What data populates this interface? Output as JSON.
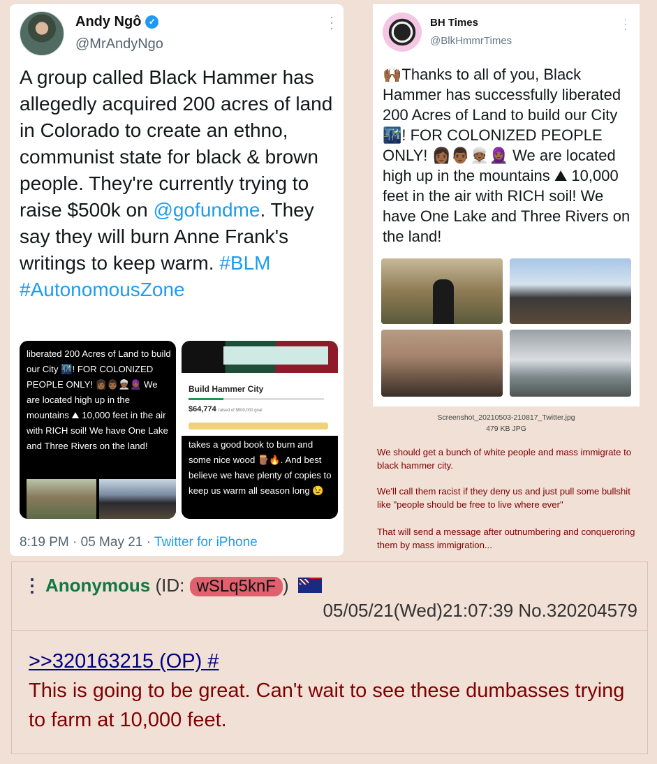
{
  "left_tweet": {
    "name": "Andy Ngô",
    "handle": "@MrAndyNgo",
    "body_main": "A group called Black Hammer has allegedly acquired 200 acres of land in Colorado to create an ethno, communist state for black & brown people. They're currently trying to raise $500k on ",
    "mention": "@gofundme",
    "body_tail": ". They say they will burn Anne Frank's writings to keep warm. ",
    "hashtag1": "#BLM",
    "hashtag2": "#AutonomousZone",
    "embed_a_text": "liberated 200 Acres of Land to build our City 🌃! FOR COLONIZED PEOPLE ONLY! 👩🏾👨🏾👳🏾🧕🏾 We are located high up in the mountains ⛰ 10,000 feet in the air with RICH soil! We have One Lake and Three Rivers on the land!",
    "embed_b_title": "Build Hammer City",
    "embed_b_amount": "$64,774",
    "embed_b_goal": "raised of $500,000 goal",
    "embed_b_text": "takes a good book to burn and some nice wood 🪵🔥. And best believe we have plenty of copies to keep us warm all season long 😉",
    "time": "8:19 PM · 05 May 21 · ",
    "source": "Twitter for iPhone"
  },
  "right_tweet": {
    "name": "BH Times",
    "handle": "@BlkHmmrTimes",
    "body": "🙌🏾Thanks to all of you, Black Hammer has successfully liberated 200 Acres of Land to build our City 🌃! FOR COLONIZED PEOPLE ONLY! 👩🏾👨🏾👳🏾🧕🏾 We are located high up in the mountains ⛰ 10,000 feet in the air with RICH soil! We have One Lake and Three Rivers on the land!"
  },
  "file": {
    "name": "Screenshot_20210503-210817_Twitter.jpg",
    "size": "479 KB JPG"
  },
  "op_message": {
    "p1": "We should get a bunch of white people and mass immigrate to black hammer city.",
    "p2": "We'll call them racist if they deny us and just pull some bullshit like \"people should be free to live where ever\"",
    "p3": "That will send a message after outnumbering and conqueroring them by mass immigration..."
  },
  "reply": {
    "menu_icon": "⋮",
    "name": "Anonymous",
    "id_prefix": "(ID: ",
    "id": "wSLq5knF",
    "id_suffix": ")",
    "datetime": "05/05/21(Wed)21:07:39 No.320204579",
    "quote": ">>320163215 (OP) #",
    "text": "This is going to be great. Can't wait to see these dumbasses trying to farm at 10,000 feet."
  },
  "colors": {
    "background": "#f0e0d6",
    "name_green": "#117743",
    "message_red": "#800000",
    "link_blue": "#1d9bf0",
    "quotelink": "#000080",
    "id_pill": "#e0606e"
  }
}
